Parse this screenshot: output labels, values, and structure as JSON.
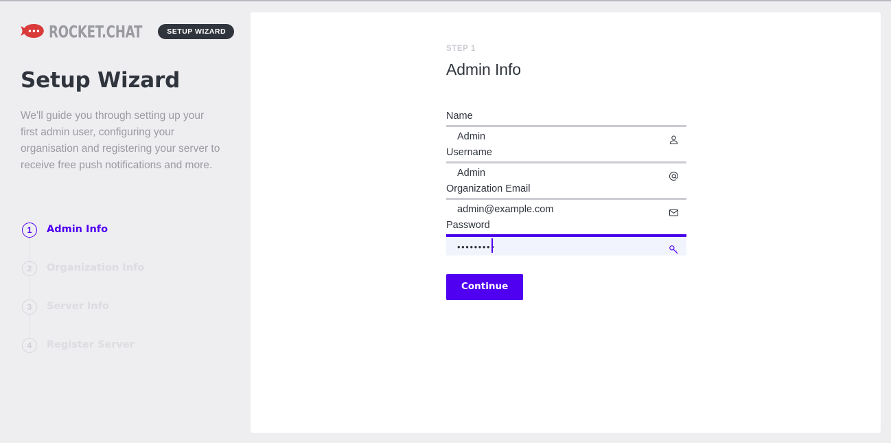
{
  "brand": {
    "logo_icon": "rocket-chat-logo-icon",
    "wordmark": "ROCKET.CHAT",
    "badge": "SETUP WIZARD"
  },
  "sidebar": {
    "title": "Setup Wizard",
    "description": "We'll guide you through setting up your first admin user, configuring your organisation and registering your server to receive free push notifications and more.",
    "steps": [
      {
        "number": "1",
        "label": "Admin Info",
        "state": "active"
      },
      {
        "number": "2",
        "label": "Organization Info",
        "state": "pending"
      },
      {
        "number": "3",
        "label": "Server Info",
        "state": "pending"
      },
      {
        "number": "4",
        "label": "Register Server",
        "state": "pending"
      }
    ]
  },
  "main": {
    "eyebrow": "STEP 1",
    "heading": "Admin Info",
    "fields": [
      {
        "label": "Name",
        "value": "Admin",
        "icon": "user-icon",
        "state": "filled"
      },
      {
        "label": "Username",
        "value": "Admin",
        "icon": "at-sign-icon",
        "state": "filled"
      },
      {
        "label": "Organization Email",
        "value": "admin@example.com",
        "icon": "envelope-icon",
        "state": "filled"
      },
      {
        "label": "Password",
        "value": "•••••••••",
        "icon": "key-icon",
        "state": "focused"
      }
    ],
    "submit_label": "Continue"
  },
  "colors": {
    "accent": "#5000f0",
    "accent_focus": "#4a00e8",
    "brand_red": "#d93b3b",
    "badge_bg": "#2f343d",
    "page_bg": "#eeeef1",
    "card_bg": "#ffffff",
    "text_dark": "#2f343d",
    "text_muted": "#9a9ba1",
    "text_disabled": "#dcdce1",
    "field_border": "#cbcbd2",
    "focus_field_bg": "#f2f4fd"
  }
}
